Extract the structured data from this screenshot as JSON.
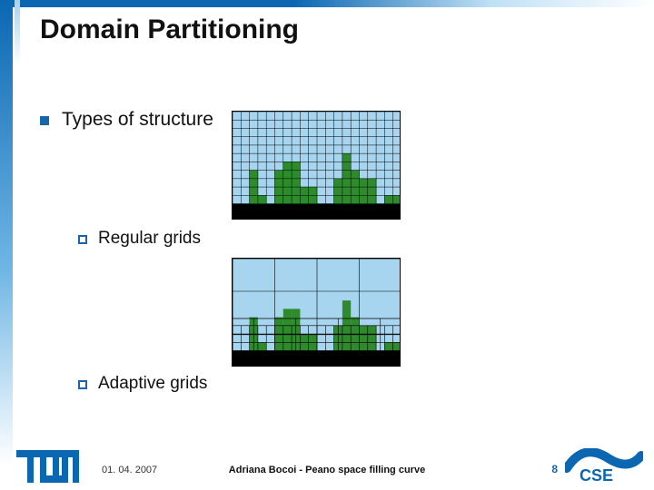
{
  "slide": {
    "title": "Domain Partitioning",
    "bullets": {
      "l1": "Types of structure",
      "l2a": "Regular grids",
      "l2b": "Adaptive grids"
    }
  },
  "grids": {
    "regular": {
      "cols": 20,
      "rows": 13,
      "sky": "#a7d4ef",
      "building": "#2f8a2b",
      "ground": "#000000",
      "ground_rows": 2,
      "heights": [
        0,
        0,
        4,
        1,
        0,
        4,
        5,
        5,
        2,
        2,
        0,
        0,
        3,
        6,
        4,
        3,
        3,
        0,
        1,
        1
      ]
    },
    "adaptive": {
      "sky": "#a7d4ef",
      "building": "#2f8a2b",
      "ground": "#000000",
      "heights": [
        0,
        0,
        4,
        1,
        0,
        4,
        5,
        5,
        2,
        2,
        0,
        0,
        3,
        6,
        4,
        3,
        3,
        0,
        1,
        1
      ]
    }
  },
  "footer": {
    "date": "01. 04. 2007",
    "title": "Adriana Bocoi - Peano space filling curve",
    "page": "8"
  },
  "logos": {
    "tum": "TUM",
    "cse": "CSE"
  }
}
